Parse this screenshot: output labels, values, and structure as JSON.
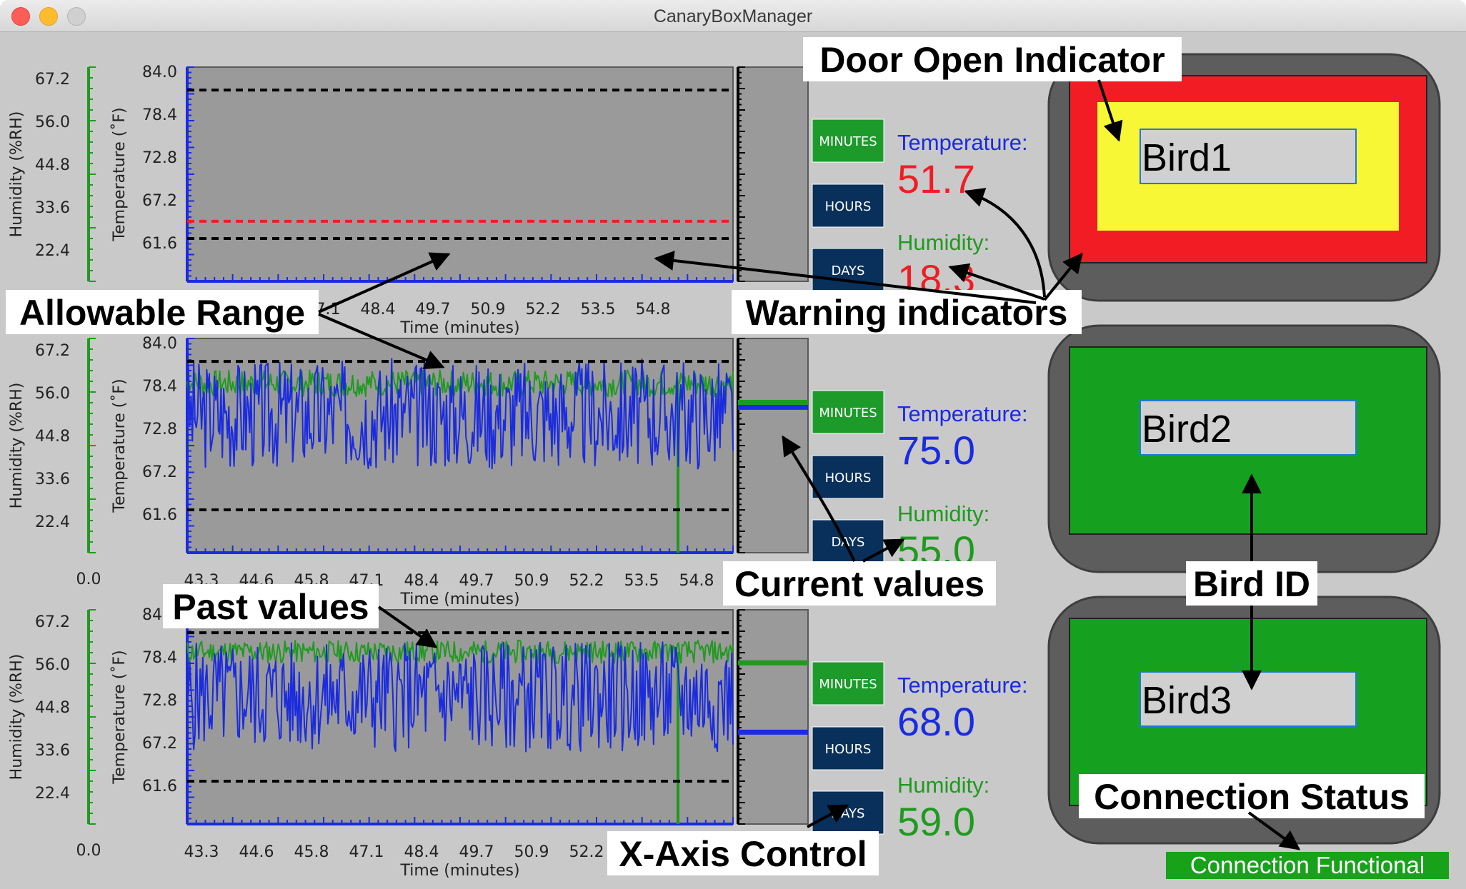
{
  "window": {
    "title": "CanaryBoxManager"
  },
  "colors": {
    "temperature": "#1a2be0",
    "humidity": "#1f9a1f",
    "warning": "#f11c24",
    "limit": "#000000",
    "plot_bg": "#9a9a9a",
    "button_minutes": "#1c9a2a",
    "button_time": "#09305a",
    "door_yellow": "#f7f736",
    "status_green": "#16a01f"
  },
  "buttons": {
    "minutes": "MINUTES",
    "hours": "HOURS",
    "days": "DAYS"
  },
  "labels": {
    "temperature": "Temperature:",
    "humidity": "Humidity:"
  },
  "panels": [
    {
      "temperature": "51.7",
      "humidity": "18.3",
      "temp_warning": true,
      "hum_warning": true,
      "bird_id": "Bird1",
      "door_open": true
    },
    {
      "temperature": "75.0",
      "humidity": "55.0",
      "temp_warning": false,
      "hum_warning": false,
      "bird_id": "Bird2",
      "door_open": false
    },
    {
      "temperature": "68.0",
      "humidity": "59.0",
      "temp_warning": false,
      "hum_warning": false,
      "bird_id": "Bird3",
      "door_open": false
    }
  ],
  "chart_data": [
    {
      "type": "line",
      "xlabel": "Time (minutes)",
      "ylabel": "Temperature (˚F)",
      "ylabel2": "Humidity (%RH)",
      "y_ticks": [
        "84.0",
        "78.4",
        "72.8",
        "67.2",
        "61.6"
      ],
      "y2_ticks": [
        "67.2",
        "56.0",
        "44.8",
        "33.6",
        "22.4"
      ],
      "x_ticks": [
        "8",
        "47.1",
        "48.4",
        "49.7",
        "50.9",
        "52.2",
        "53.5",
        "54.8"
      ],
      "ylim": [
        56.0,
        84.0
      ],
      "y2lim": [
        0.0,
        78.4
      ],
      "temp_range": [
        61.6,
        81.0
      ],
      "temp_range_color": "#000000",
      "hum_range": [
        22.0
      ],
      "hum_range_color": "#f11c24",
      "series": [],
      "current": {}
    },
    {
      "type": "line",
      "xlabel": "Time (minutes)",
      "ylabel": "Temperature (˚F)",
      "ylabel2": "Humidity (%RH)",
      "y_ticks": [
        "84.0",
        "78.4",
        "72.8",
        "67.2",
        "61.6"
      ],
      "y2_ticks": [
        "67.2",
        "56.0",
        "44.8",
        "33.6",
        "22.4"
      ],
      "y2_min_label": "0.0",
      "x_ticks": [
        "43.3",
        "44.6",
        "45.8",
        "47.1",
        "48.4",
        "49.7",
        "50.9",
        "52.2",
        "53.5",
        "54.8"
      ],
      "xlim": [
        42.9,
        55.8
      ],
      "ylim": [
        56.0,
        84.0
      ],
      "y2lim": [
        0.0,
        78.4
      ],
      "temp_range": [
        61.6,
        81.0
      ],
      "temp_range_color": "#000000",
      "series": [
        {
          "variable": "humidity",
          "color": "#1f9a1f",
          "base": 62.0,
          "amp": 7.5,
          "seed": 7,
          "dropout_x": 54.5,
          "dropout_value": 0.0
        },
        {
          "variable": "temperature",
          "color": "#1a2be0",
          "base": 72.0,
          "amp": 9.0,
          "seed": 3
        }
      ],
      "current": {
        "temperature": 75.0,
        "humidity": 55.0
      }
    },
    {
      "type": "line",
      "xlabel": "Time (minutes)",
      "ylabel": "Temperature (˚F)",
      "ylabel2": "Humidity (%RH)",
      "y_ticks": [
        "84.0",
        "78.4",
        "72.8",
        "67.2",
        "61.6"
      ],
      "y2_ticks": [
        "67.2",
        "56.0",
        "44.8",
        "33.6",
        "22.4"
      ],
      "y2_min_label": "0.0",
      "x_ticks": [
        "43.3",
        "44.6",
        "45.8",
        "47.1",
        "48.4",
        "49.7",
        "50.9",
        "52.2"
      ],
      "xlim": [
        42.9,
        55.8
      ],
      "ylim": [
        56.0,
        84.0
      ],
      "y2lim": [
        0.0,
        78.4
      ],
      "temp_range": [
        61.6,
        81.0
      ],
      "temp_range_color": "#000000",
      "series": [
        {
          "variable": "humidity",
          "color": "#1f9a1f",
          "base": 63.0,
          "amp": 6.5,
          "seed": 11,
          "dropout_x": 54.5,
          "dropout_value": 0.0
        },
        {
          "variable": "temperature",
          "color": "#1a2be0",
          "base": 70.5,
          "amp": 9.0,
          "seed": 5
        }
      ],
      "current": {
        "temperature": 68.0,
        "humidity": 59.0
      }
    }
  ],
  "annotations": {
    "door_open_indicator": "Door Open Indicator",
    "allowable_range": "Allowable Range",
    "warning_indicators": "Warning indicators",
    "current_values": "Current values",
    "bird_id": "Bird ID",
    "past_values": "Past values",
    "connection_status": "Connection Status",
    "x_axis_control": "X-Axis Control"
  },
  "connection_status": "Connection Functional"
}
